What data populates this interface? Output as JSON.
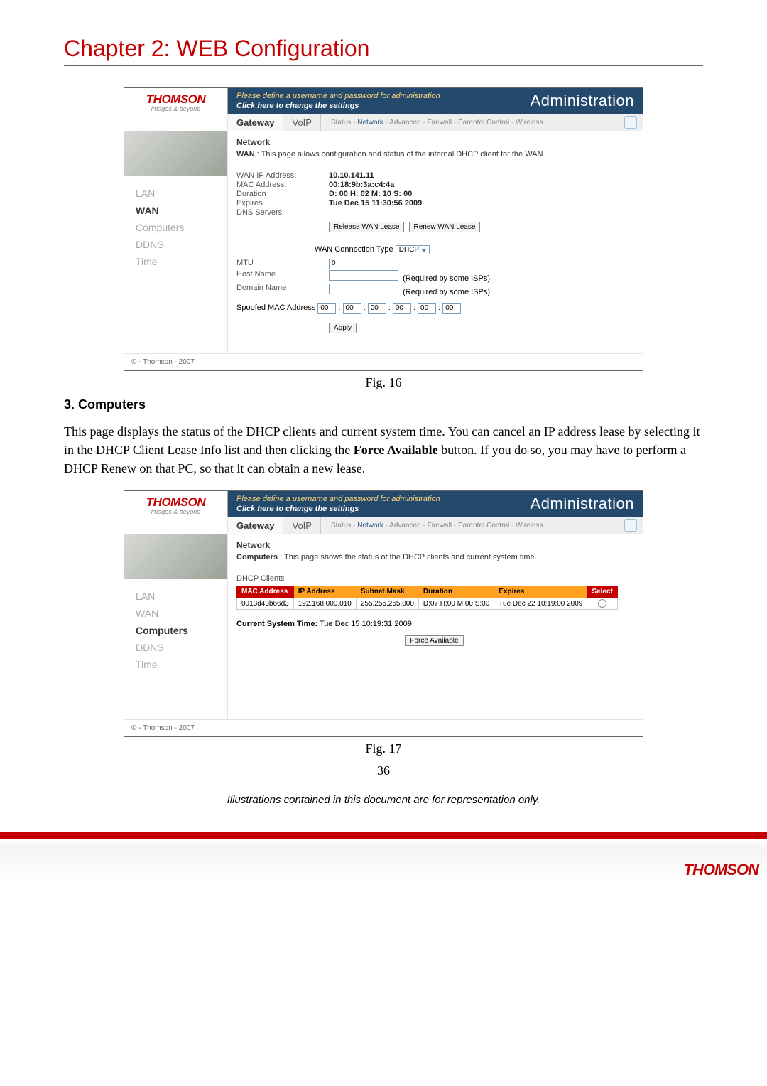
{
  "chapter_title": "Chapter 2: WEB Configuration",
  "fig16": {
    "logo": "THOMSON",
    "logo_sub": "images & beyond",
    "banner_line1": "Please define a username and password for administration",
    "banner_line2_pre": "Click ",
    "banner_line2_link": "here",
    "banner_line2_post": " to change the settings",
    "banner_right": "Administration",
    "tabs": {
      "gateway": "Gateway",
      "voip": "VoIP"
    },
    "subnav": {
      "status": "Status",
      "network": "Network",
      "advanced": "Advanced",
      "firewall": "Firewall",
      "parental": "Parental Control",
      "wireless": "Wireless"
    },
    "side": {
      "lan": "LAN",
      "wan": "WAN",
      "computers": "Computers",
      "ddns": "DDNS",
      "time": "Time"
    },
    "section_hdr": "Network",
    "section_desc_label": "WAN",
    "section_desc": "This page allows configuration and status of the internal DHCP client for the WAN.",
    "kv": {
      "wan_ip_lbl": "WAN IP Address:",
      "wan_ip": "10.10.141.11",
      "mac_lbl": "MAC Address:",
      "mac": "00:18:9b:3a:c4:4a",
      "dur_lbl": "Duration",
      "dur": "D: 00 H: 02 M: 10 S: 00",
      "exp_lbl": "Expires",
      "exp": "Tue Dec 15 11:30:56 2009",
      "dns_lbl": "DNS Servers"
    },
    "btn_release": "Release WAN Lease",
    "btn_renew": "Renew WAN Lease",
    "conn_type_lbl": "WAN Connection Type",
    "conn_type_val": "DHCP",
    "mtu_lbl": "MTU",
    "mtu_val": "0",
    "host_lbl": "Host Name",
    "host_note": "(Required by some ISPs)",
    "domain_lbl": "Domain Name",
    "domain_note": "(Required by some ISPs)",
    "spoof_lbl": "Spoofed MAC Address",
    "spoof": [
      "00",
      "00",
      "00",
      "00",
      "00",
      "00"
    ],
    "btn_apply": "Apply",
    "copyright": "© - Thomson - 2007",
    "caption": "Fig. 16"
  },
  "section3": {
    "heading": "3. Computers",
    "para_part1": "This page displays the status of the DHCP clients and current system time. You can cancel an IP address lease by selecting it in the DHCP Client Lease Info list and then clicking the ",
    "para_bold": "Force Available",
    "para_part2": " button. If you do so, you may have to perform a DHCP Renew on that PC, so that it can obtain a new lease."
  },
  "fig17": {
    "section_desc_label": "Computers",
    "section_desc": "This page shows the status of the DHCP clients and current system time.",
    "dhcp_hdr": "DHCP Clients",
    "cols": {
      "mac": "MAC Address",
      "ip": "IP Address",
      "mask": "Subnet Mask",
      "dur": "Duration",
      "exp": "Expires",
      "sel": "Select"
    },
    "row": {
      "mac": "0013d43b66d3",
      "ip": "192.168.000.010",
      "mask": "255.255.255.000",
      "dur": "D:07 H:00 M:00 S:00",
      "exp": "Tue Dec 22 10:19:00 2009"
    },
    "systime_lbl": "Current System Time:",
    "systime_val": "Tue Dec 15 10:19:31 2009",
    "btn_force": "Force Available",
    "caption": "Fig. 17"
  },
  "page_number": "36",
  "disclaimer": "Illustrations contained in this document are for representation only.",
  "footer_logo": "THOMSON"
}
